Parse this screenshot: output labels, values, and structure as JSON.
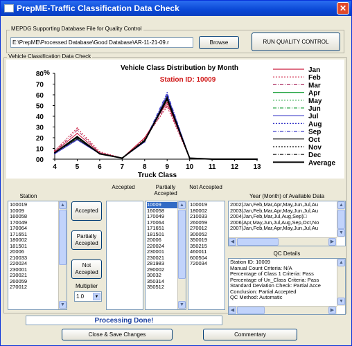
{
  "window": {
    "title": "PrepME-Traffic Classification Data Check",
    "close_glyph": "✕"
  },
  "db": {
    "legend": "MEPDG Supporting Database File for Quality Control",
    "path": "E:\\PrepME\\Processed Database\\Good Database\\AR-11-21-09.r",
    "browse_label": "Browse",
    "run_label": "RUN QUALITY CONTROL"
  },
  "check": {
    "legend": "Vehicle Classification Data Check"
  },
  "chart_data": {
    "type": "line",
    "title": "Vehicle Class Distribution by Month",
    "subtitle": "Station ID: 10009",
    "xlabel": "Truck Class",
    "ylabel": "%",
    "x": [
      4,
      5,
      6,
      7,
      8,
      9,
      10,
      11,
      12,
      13
    ],
    "ylim": [
      0,
      80
    ],
    "yticks": [
      "00",
      "10",
      "20",
      "30",
      "40",
      "50",
      "60",
      "70",
      "80"
    ],
    "series": [
      {
        "name": "Jan",
        "color": "#cc1a3c",
        "dash": "",
        "values": [
          7,
          24,
          6,
          1,
          20,
          53,
          1,
          0,
          0,
          0
        ]
      },
      {
        "name": "Feb",
        "color": "#cc1a3c",
        "dash": "2,2",
        "values": [
          8,
          29,
          7,
          1,
          19,
          49,
          1,
          0,
          0,
          0
        ]
      },
      {
        "name": "Mar",
        "color": "#b03a6a",
        "dash": "5,2,1,2",
        "values": [
          7,
          27,
          6,
          1,
          18,
          51,
          1,
          0,
          0,
          0
        ]
      },
      {
        "name": "Apr",
        "color": "#2ea84a",
        "dash": "",
        "values": [
          6,
          20,
          5,
          1,
          17,
          56,
          1,
          0,
          0,
          0
        ]
      },
      {
        "name": "May",
        "color": "#2ea84a",
        "dash": "2,2",
        "values": [
          6,
          21,
          5,
          1,
          18,
          55,
          1,
          0,
          0,
          0
        ]
      },
      {
        "name": "Jun",
        "color": "#2ea84a",
        "dash": "5,2,1,2",
        "values": [
          6,
          20,
          5,
          1,
          17,
          57,
          1,
          0,
          0,
          0
        ]
      },
      {
        "name": "Jul",
        "color": "#3838c8",
        "dash": "",
        "values": [
          5,
          18,
          5,
          1,
          16,
          60,
          1,
          0,
          0,
          0
        ]
      },
      {
        "name": "Aug",
        "color": "#3838c8",
        "dash": "2,2",
        "values": [
          5,
          19,
          5,
          1,
          16,
          59,
          1,
          0,
          0,
          0
        ]
      },
      {
        "name": "Sep",
        "color": "#3838c8",
        "dash": "5,2,1,2",
        "values": [
          5,
          18,
          5,
          1,
          17,
          62,
          1,
          0,
          0,
          0
        ]
      },
      {
        "name": "Oct",
        "color": "#111111",
        "dash": "",
        "values": [
          6,
          19,
          5,
          1,
          17,
          58,
          1,
          0,
          0,
          0
        ]
      },
      {
        "name": "Nov",
        "color": "#111111",
        "dash": "2,2",
        "values": [
          6,
          20,
          5,
          1,
          17,
          57,
          1,
          0,
          0,
          0
        ]
      },
      {
        "name": "Dec",
        "color": "#111111",
        "dash": "5,2,1,2",
        "values": [
          6,
          21,
          5,
          1,
          18,
          56,
          1,
          0,
          0,
          0
        ]
      },
      {
        "name": "Average",
        "color": "#000000",
        "dash": "",
        "width": 2,
        "values": [
          6,
          21,
          5,
          1,
          17,
          56,
          1,
          0,
          0,
          0
        ]
      }
    ]
  },
  "headers": {
    "station": "Station",
    "accepted": "Accepted",
    "partially_accepted": "Partially Accepted",
    "not_accepted": "Not Accepted",
    "year_month": "Year (Month) of Available Data",
    "qc_details": "QC Details"
  },
  "stations": [
    "100019",
    "10009",
    "160058",
    "170049",
    "170064",
    "171651",
    "180002",
    "181501",
    "20006",
    "210033",
    "220024",
    "230001",
    "230021",
    "260059",
    "270012"
  ],
  "buttons": {
    "accepted": "Accepted",
    "partially": "Partially Accepted",
    "not_accepted": "Not Accepted",
    "multiplier": "Multiplier",
    "multiplier_value": "1.0",
    "close_save": "Close & Save Changes",
    "commentary": "Commentary"
  },
  "partially_list": [
    "10009",
    "160058",
    "170049",
    "170064",
    "171651",
    "181501",
    "20006",
    "220024",
    "230001",
    "230021",
    "281983",
    "290002",
    "30032",
    "350314",
    "350512"
  ],
  "not_list": [
    "100019",
    "180002",
    "210033",
    "260059",
    "270012",
    "300052",
    "350019",
    "350215",
    "460011",
    "600504",
    "720034"
  ],
  "years": [
    "2002(Jan,Feb,Mar,Apr,May,Jun,Jul,Au",
    "2003(Jan,Feb,Mar,Apr,May,Jun,Jul,Au",
    "2004(Jan,Feb,Mar,Jul,Aug,Sep)□",
    "2006(Apr,May,Jun,Jul,Aug,Sep,Oct,No",
    "2007(Jan,Feb,Mar,Apr,May,Jun,Jul,Au"
  ],
  "qc": [
    "Station ID: 10009",
    "Manual Count Criteria: N/A",
    "Percentage of Class 1 Criteria: Pass",
    "Percentage of Un_Class Criteria: Pass",
    "Standard Deviation Check: Partial Acce",
    "Conclusion: Partial Accepted",
    "QC Method: Automatic"
  ],
  "status": "Processing Done!"
}
